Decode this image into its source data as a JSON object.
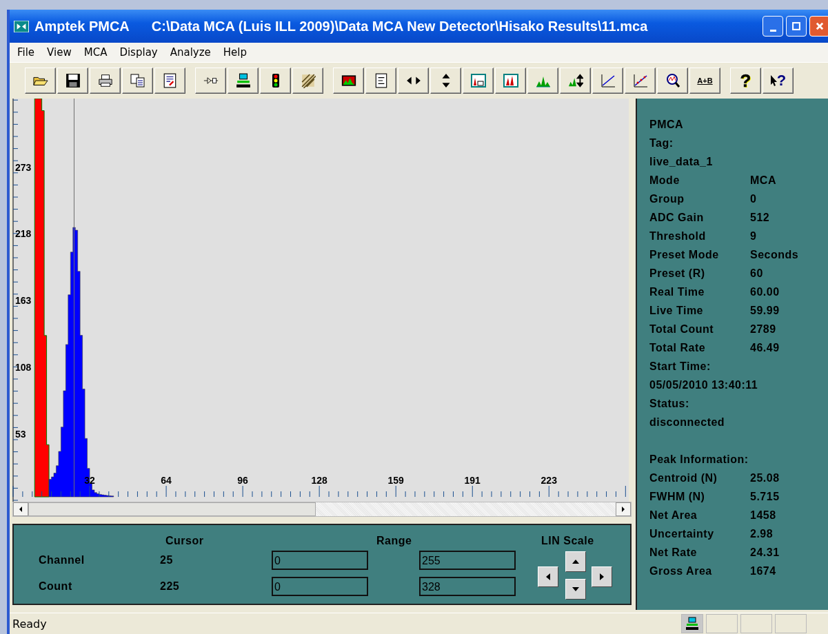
{
  "window": {
    "title": "Amptek PMCA",
    "path": "C:\\Data MCA (Luis ILL 2009)\\Data MCA New Detector\\Hisako Results\\11.mca"
  },
  "menu": [
    "File",
    "View",
    "MCA",
    "Display",
    "Analyze",
    "Help"
  ],
  "toolbar": [
    [
      {
        "kind": "open"
      },
      {
        "kind": "save"
      },
      {
        "kind": "print"
      },
      {
        "kind": "copy"
      },
      {
        "kind": "report"
      }
    ],
    [
      {
        "kind": "connect"
      },
      {
        "kind": "computer"
      },
      {
        "kind": "traffic"
      },
      {
        "kind": "hatch"
      }
    ],
    [
      {
        "kind": "spectrum"
      },
      {
        "kind": "list"
      },
      {
        "kind": "harrows"
      },
      {
        "kind": "varrows"
      },
      {
        "kind": "peakbox"
      },
      {
        "kind": "peaks"
      },
      {
        "kind": "greenpeaks"
      },
      {
        "kind": "peakscale"
      },
      {
        "kind": "line"
      },
      {
        "kind": "calib"
      },
      {
        "kind": "zoom"
      },
      {
        "kind": "text",
        "label": "A+B"
      }
    ],
    [
      {
        "kind": "text",
        "label": "?"
      },
      {
        "kind": "helpcursor",
        "label": "?"
      }
    ]
  ],
  "chart": {
    "yticks": [
      "273",
      "218",
      "163",
      "108",
      "53"
    ],
    "xticks": [
      "32",
      "64",
      "96",
      "128",
      "159",
      "191",
      "223"
    ]
  },
  "controls": {
    "cursor_header": "Cursor",
    "range_header": "Range",
    "scale_header": "LIN Scale",
    "rows": [
      {
        "label": "Channel",
        "cursor": "25",
        "from": "0",
        "to": "255"
      },
      {
        "label": "Count",
        "cursor": "225",
        "from": "0",
        "to": "328"
      }
    ]
  },
  "info": [
    {
      "kind": "line",
      "label": "PMCA"
    },
    {
      "kind": "line",
      "label": "Tag:"
    },
    {
      "kind": "line",
      "label": "live_data_1"
    },
    {
      "kind": "pair",
      "label": "Mode",
      "value": "MCA"
    },
    {
      "kind": "pair",
      "label": "Group",
      "value": "0"
    },
    {
      "kind": "pair",
      "label": "ADC Gain",
      "value": "512"
    },
    {
      "kind": "pair",
      "label": "Threshold",
      "value": "9"
    },
    {
      "kind": "pair",
      "label": "Preset Mode",
      "value": "Seconds"
    },
    {
      "kind": "pair",
      "label": "Preset (R)",
      "value": "60"
    },
    {
      "kind": "pair",
      "label": "Real Time",
      "value": "60.00"
    },
    {
      "kind": "pair",
      "label": "Live Time",
      "value": "59.99"
    },
    {
      "kind": "pair",
      "label": "Total Count",
      "value": "2789"
    },
    {
      "kind": "pair",
      "label": "Total Rate",
      "value": "46.49"
    },
    {
      "kind": "line",
      "label": "Start Time:"
    },
    {
      "kind": "line",
      "label": "05/05/2010 13:40:11"
    },
    {
      "kind": "line",
      "label": "Status:"
    },
    {
      "kind": "line",
      "label": "disconnected"
    },
    {
      "kind": "heading",
      "label": "Peak Information:"
    },
    {
      "kind": "pair",
      "label": "Centroid (N)",
      "value": "25.08"
    },
    {
      "kind": "pair",
      "label": "FWHM (N)",
      "value": "5.715"
    },
    {
      "kind": "pair",
      "label": "Net Area",
      "value": "1458"
    },
    {
      "kind": "pair",
      "label": "Uncertainty",
      "value": "2.98"
    },
    {
      "kind": "pair",
      "label": "Net Rate",
      "value": "24.31"
    },
    {
      "kind": "pair",
      "label": "Gross Area",
      "value": "1674"
    }
  ],
  "status_bar": {
    "text": "Ready"
  }
}
